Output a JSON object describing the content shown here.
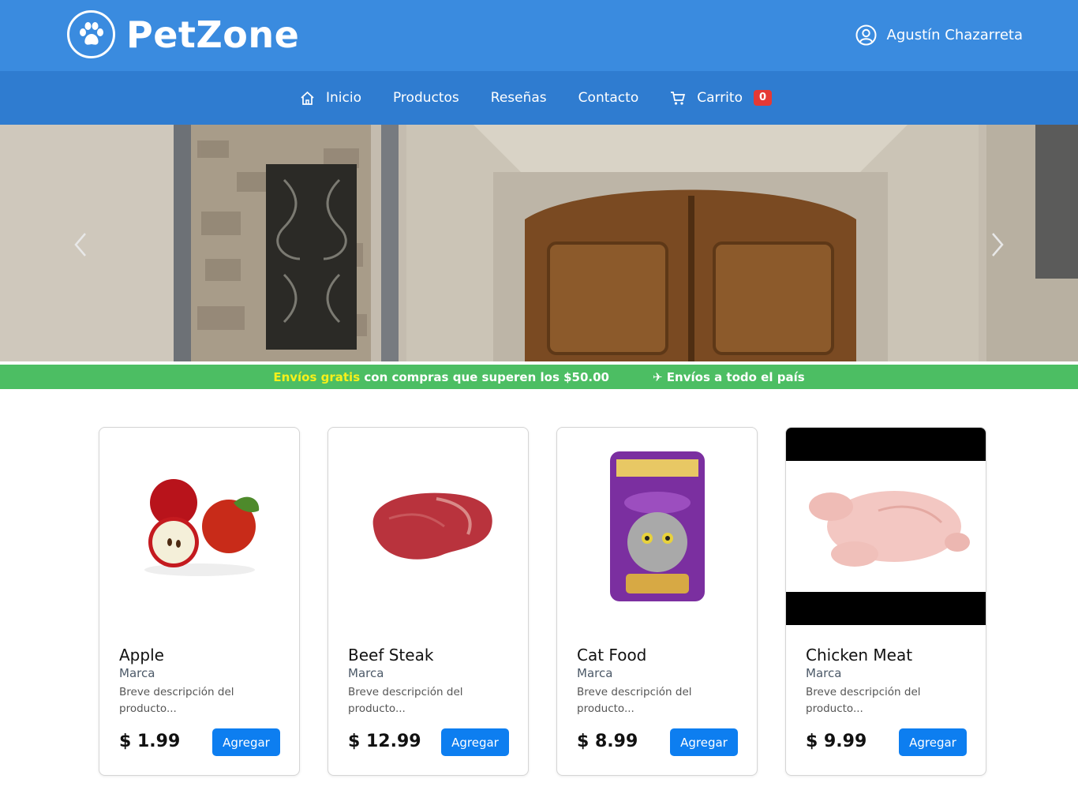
{
  "header": {
    "brand": "PetZone",
    "user_name": "Agustín Chazarreta"
  },
  "nav": {
    "items": [
      {
        "label": "Inicio"
      },
      {
        "label": "Productos"
      },
      {
        "label": "Reseñas"
      },
      {
        "label": "Contacto"
      },
      {
        "label": "Carrito"
      }
    ],
    "cart_count": "0"
  },
  "promo": {
    "highlight": "Envíos gratis",
    "text": "con compras que superen los $50.00",
    "shipping": "✈ Envíos a todo el país"
  },
  "products": [
    {
      "name": "Apple",
      "brand": "Marca",
      "description": "Breve descripción del producto...",
      "price": "$ 1.99",
      "button": "Agregar"
    },
    {
      "name": "Beef Steak",
      "brand": "Marca",
      "description": "Breve descripción del producto...",
      "price": "$ 12.99",
      "button": "Agregar"
    },
    {
      "name": "Cat Food",
      "brand": "Marca",
      "description": "Breve descripción del producto...",
      "price": "$ 8.99",
      "button": "Agregar"
    },
    {
      "name": "Chicken Meat",
      "brand": "Marca",
      "description": "Breve descripción del producto...",
      "price": "$ 9.99",
      "button": "Agregar"
    }
  ],
  "colors": {
    "header": "#3a8bdf",
    "nav": "#2f7cd0",
    "promo": "#4cbe63",
    "button": "#0d7ef0",
    "badge": "#e53935"
  }
}
